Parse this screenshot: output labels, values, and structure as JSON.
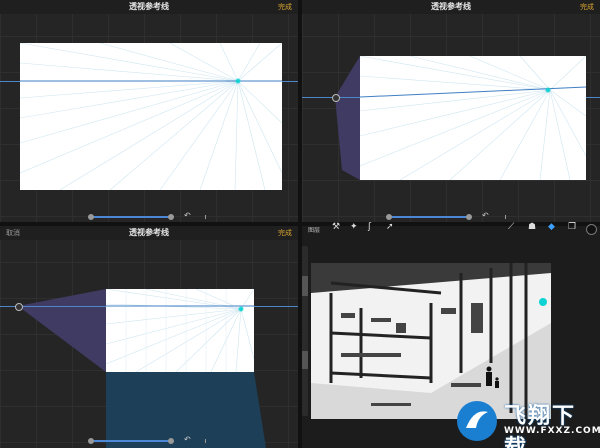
{
  "panels": {
    "tl": {
      "cancel": "",
      "title": "透视参考线",
      "done": "完成"
    },
    "tr": {
      "cancel": "",
      "title": "透视参考线",
      "done": "完成"
    },
    "bl": {
      "cancel": "取消",
      "title": "透视参考线",
      "done": "完成"
    }
  },
  "toolbar": {
    "label": "图层"
  },
  "logo": {
    "brand": "飞翔下载",
    "url": "WWW.FXXZ.COM"
  },
  "colors": {
    "accent": "#d6a532",
    "horizon": "#4c88c9",
    "vanishing": "#0fd3d3",
    "fill_blue": "#1d3f57",
    "frustum": "#3f3b63"
  }
}
